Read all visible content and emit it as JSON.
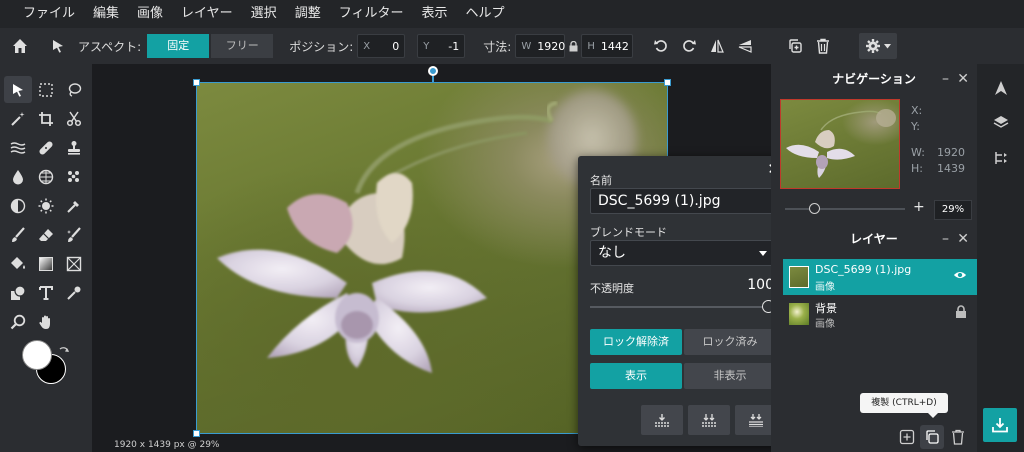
{
  "menu": [
    "ファイル",
    "編集",
    "画像",
    "レイヤー",
    "選択",
    "調整",
    "フィルター",
    "表示",
    "ヘルプ"
  ],
  "toolbar": {
    "aspect_label": "アスペクト:",
    "fixed": "固定",
    "free": "フリー",
    "position_label": "ポジション:",
    "x_key": "X",
    "x_value": "0",
    "y_key": "Y",
    "y_value": "-1",
    "size_label": "寸法:",
    "w_key": "W",
    "w_value": "1920",
    "h_key": "H",
    "h_value": "1442"
  },
  "canvas": {
    "status": "1920 x 1439 px @ 29%"
  },
  "popup": {
    "name_label": "名前",
    "name_value": "DSC_5699 (1).jpg",
    "blend_label": "ブレンドモード",
    "blend_value": "なし",
    "opacity_label": "不透明度",
    "opacity_value": "100",
    "opacity_fraction": 1.0,
    "unlocked": "ロック解除済",
    "locked": "ロック済み",
    "show": "表示",
    "hide": "非表示"
  },
  "navigator": {
    "title": "ナビゲーション",
    "x_label": "X:",
    "y_label": "Y:",
    "w_label": "W:",
    "w_value": "1920",
    "h_label": "H:",
    "h_value": "1439",
    "zoom": "29%"
  },
  "layers": {
    "title": "レイヤー",
    "items": [
      {
        "name": "DSC_5699 (1).jpg",
        "type": "画像",
        "selected": true
      },
      {
        "name": "背景",
        "type": "画像",
        "selected": false
      }
    ]
  },
  "tooltip": "複製 (CTRL+D)",
  "colors": {
    "accent": "#13a1a3",
    "primary": "#ffffff",
    "secondary": "#000000",
    "selection": "#3a9bd0"
  }
}
